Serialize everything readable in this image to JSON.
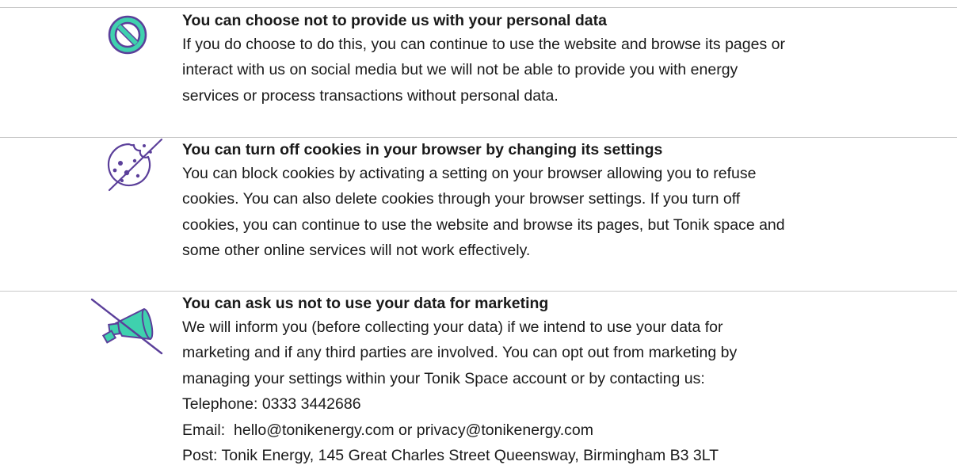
{
  "sections": [
    {
      "icon": "no-entry-icon",
      "heading": "You can choose not to provide us with your personal data",
      "lines": [
        "If you do choose to do this, you can continue to use the website and browse its pages or",
        "interact with us on social media but we will not be able to provide you with energy",
        "services or process transactions without personal data."
      ]
    },
    {
      "icon": "crossed-out-cookie-icon",
      "heading": "You can turn off cookies in your browser by changing its settings",
      "lines": [
        "You can block cookies by activating a setting on your browser allowing you to refuse",
        "cookies. You can also delete cookies through your browser settings. If you turn off",
        "cookies, you can continue to use the website and browse its pages, but Tonik space and",
        "some other online services will not work effectively."
      ]
    },
    {
      "icon": "muted-megaphone-icon",
      "heading": "You can ask us not to use your data for marketing",
      "lines": [
        "We will inform you (before collecting your data) if we intend to use your data for",
        "marketing and if any third parties are involved. You can opt out from marketing by",
        "managing your settings within your Tonik Space account or by contacting us:",
        "Telephone: 0333 3442686",
        "Email:  hello@tonikenergy.com or privacy@tonikenergy.com",
        "Post: Tonik Energy, 145 Great Charles Street Queensway, Birmingham B3 3LT"
      ]
    }
  ],
  "colors": {
    "teal": "#3fd1ae",
    "purple": "#5b3f9a",
    "rule": "#c8c8c8",
    "text": "#1a1a1a"
  }
}
